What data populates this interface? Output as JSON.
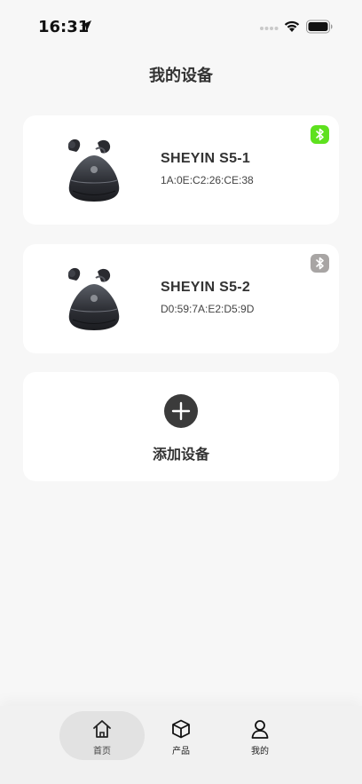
{
  "status_bar": {
    "time": "16:31",
    "location_icon": "location-arrow-icon",
    "signal_icon": "cellular-signal-icon",
    "wifi_icon": "wifi-icon",
    "battery_icon": "battery-icon"
  },
  "header": {
    "title": "我的设备"
  },
  "devices": [
    {
      "name": "SHEYIN S5-1",
      "mac": "1A:0E:C2:26:CE:38",
      "bluetooth_status": "connected",
      "bluetooth_color": "#5ee11e",
      "image_icon": "earbud-case-icon"
    },
    {
      "name": "SHEYIN S5-2",
      "mac": "D0:59:7A:E2:D5:9D",
      "bluetooth_status": "disconnected",
      "bluetooth_color": "#a8a5a4",
      "image_icon": "earbud-case-icon"
    }
  ],
  "add_device": {
    "label": "添加设备",
    "icon": "plus-circle-icon"
  },
  "tab_bar": {
    "active": "home",
    "tabs": [
      {
        "id": "home",
        "label": "首页",
        "icon": "home-icon"
      },
      {
        "id": "product",
        "label": "产品",
        "icon": "box-icon"
      },
      {
        "id": "mine",
        "label": "我的",
        "icon": "user-icon"
      }
    ]
  },
  "colors": {
    "background": "#f7f7f7",
    "card": "#ffffff",
    "bluetooth_connected": "#5ee11e",
    "bluetooth_disconnected": "#a8a5a4",
    "tab_active_pill": "#e2e2e2"
  }
}
